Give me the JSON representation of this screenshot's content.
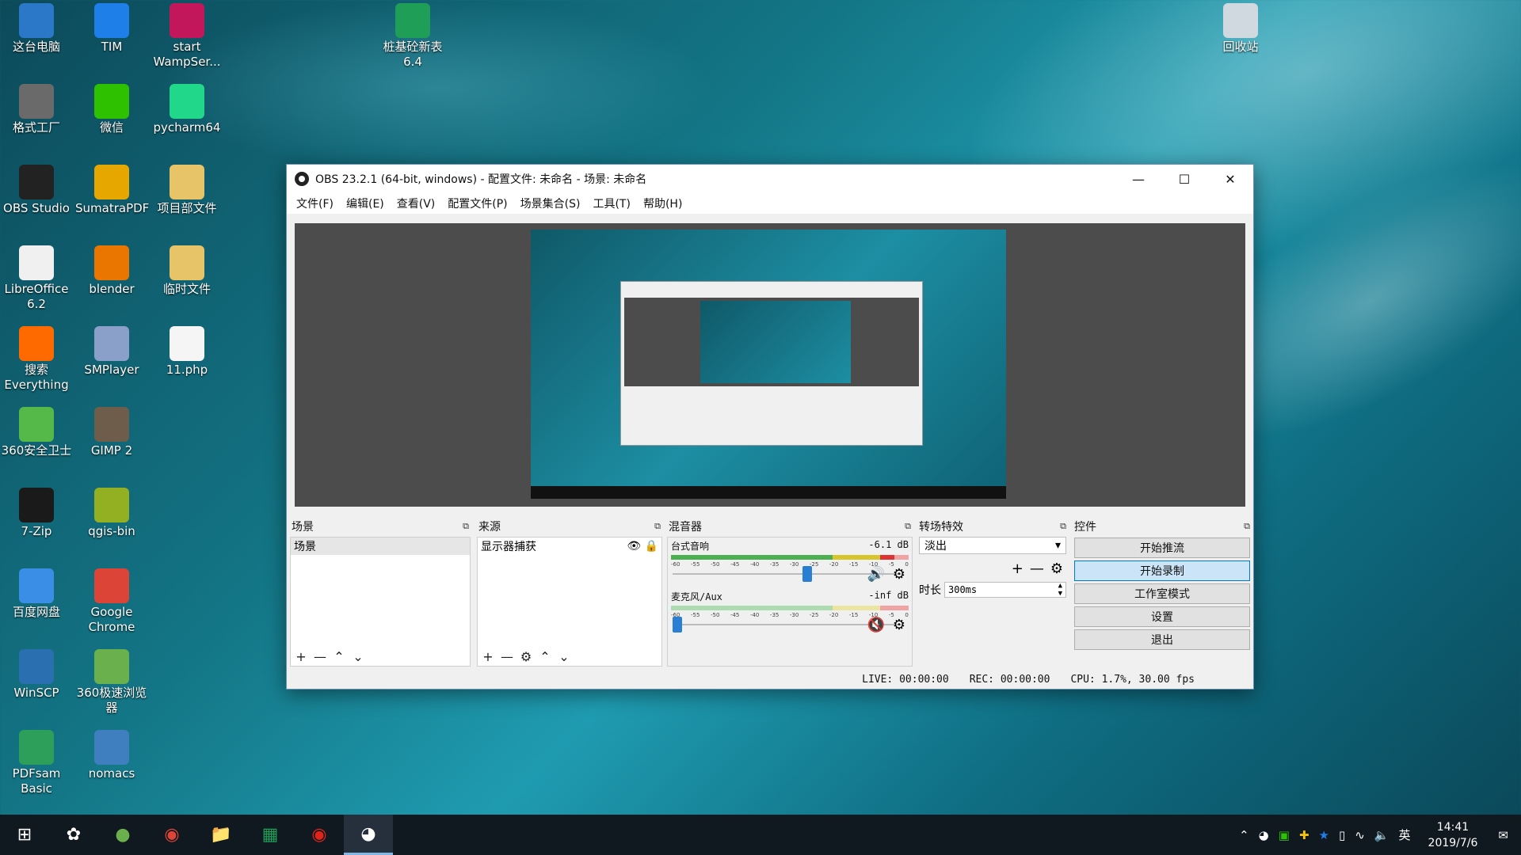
{
  "desktop": {
    "icons": [
      {
        "label": "这台电脑",
        "icon": "computer-icon",
        "color": "#2b78c8"
      },
      {
        "label": "TIM",
        "icon": "tim-icon",
        "color": "#1f7fe8"
      },
      {
        "label": "start WampSer...",
        "icon": "wampserver-icon",
        "color": "#c2185b"
      },
      {
        "label": "格式工厂",
        "icon": "format-factory-icon",
        "color": "#6a6a6a"
      },
      {
        "label": "微信",
        "icon": "wechat-icon",
        "color": "#2dc100"
      },
      {
        "label": "pycharm64",
        "icon": "pycharm-icon",
        "color": "#21d789"
      },
      {
        "label": "OBS Studio",
        "icon": "obs-icon",
        "color": "#222222"
      },
      {
        "label": "SumatraPDF",
        "icon": "sumatrapdf-icon",
        "color": "#e6a800"
      },
      {
        "label": "项目部文件",
        "icon": "folder-icon",
        "color": "#e8c468"
      },
      {
        "label": "LibreOffice 6.2",
        "icon": "libreoffice-icon",
        "color": "#f0f0f0"
      },
      {
        "label": "blender",
        "icon": "blender-icon",
        "color": "#ea7600"
      },
      {
        "label": "临时文件",
        "icon": "folder-icon",
        "color": "#e8c468"
      },
      {
        "label": "搜索 Everything",
        "icon": "everything-search-icon",
        "color": "#ff6a00"
      },
      {
        "label": "SMPlayer",
        "icon": "smplayer-icon",
        "color": "#8aa0c8"
      },
      {
        "label": "11.php",
        "icon": "file-icon",
        "color": "#f5f5f5"
      },
      {
        "label": "360安全卫士",
        "icon": "360-security-icon",
        "color": "#54b948"
      },
      {
        "label": "GIMP 2",
        "icon": "gimp-icon",
        "color": "#6e5d4b"
      },
      {
        "label": "7-Zip",
        "icon": "7zip-icon",
        "color": "#1a1a1a"
      },
      {
        "label": "qgis-bin",
        "icon": "qgis-icon",
        "color": "#93b023"
      },
      {
        "label": "百度网盘",
        "icon": "baidu-netdisk-icon",
        "color": "#3a8ee6"
      },
      {
        "label": "Google Chrome",
        "icon": "chrome-icon",
        "color": "#db4437"
      },
      {
        "label": "WinSCP",
        "icon": "winscp-icon",
        "color": "#2a6fb0"
      },
      {
        "label": "360极速浏览器",
        "icon": "360-browser-icon",
        "color": "#6ab04c"
      },
      {
        "label": "PDFsam Basic",
        "icon": "pdfsam-icon",
        "color": "#2e9e5b"
      },
      {
        "label": "nomacs",
        "icon": "nomacs-icon",
        "color": "#3f7fbf"
      },
      {
        "label": "桩基砼新表 6.4",
        "icon": "spreadsheet-icon",
        "color": "#1e9e57"
      },
      {
        "label": "回收站",
        "icon": "recycle-bin-icon",
        "color": "#d0d8e0"
      }
    ]
  },
  "obs": {
    "title": "OBS 23.2.1 (64-bit, windows) - 配置文件: 未命名 - 场景: 未命名",
    "menu": [
      "文件(F)",
      "编辑(E)",
      "查看(V)",
      "配置文件(P)",
      "场景集合(S)",
      "工具(T)",
      "帮助(H)"
    ],
    "docks": {
      "scenes": {
        "title": "场景",
        "items": [
          "场景"
        ]
      },
      "sources": {
        "title": "来源",
        "items": [
          "显示器捕获"
        ]
      },
      "mixer": {
        "title": "混音器",
        "channels": [
          {
            "name": "台式音响",
            "level": "-6.1 dB",
            "muted": false,
            "volume": 0.5
          },
          {
            "name": "麦克风/Aux",
            "level": "-inf dB",
            "muted": true,
            "volume": 0.0
          }
        ],
        "scale": [
          "-60",
          "-55",
          "-50",
          "-45",
          "-40",
          "-35",
          "-30",
          "-25",
          "-20",
          "-15",
          "-10",
          "-5",
          "0"
        ]
      },
      "transitions": {
        "title": "转场特效",
        "selected": "淡出",
        "duration_label": "时长",
        "duration": "300ms"
      },
      "controls": {
        "title": "控件",
        "buttons": [
          "开始推流",
          "开始录制",
          "工作室模式",
          "设置",
          "退出"
        ]
      }
    },
    "status": {
      "live": "LIVE: 00:00:00",
      "rec": "REC: 00:00:00",
      "cpu": "CPU: 1.7%, 30.00 fps"
    }
  },
  "taskbar": {
    "clock_time": "14:41",
    "clock_date": "2019/7/6",
    "ime": "英",
    "pinned": [
      "windows-start-icon",
      "obs-flower-icon",
      "360-browser-icon",
      "chrome-icon",
      "file-explorer-icon",
      "spreadsheet-icon",
      "netease-music-icon",
      "obs-icon"
    ]
  }
}
